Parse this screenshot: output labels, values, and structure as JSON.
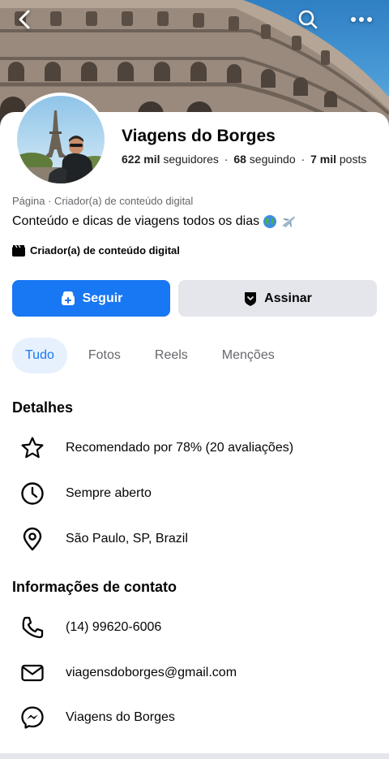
{
  "cover": {
    "back_icon": "chevron-left-icon",
    "search_icon": "search-icon",
    "more_icon": "more-horizontal-icon"
  },
  "profile": {
    "name": "Viagens do Borges",
    "followers_count": "622 mil",
    "followers_label": "seguidores",
    "following_count": "68",
    "following_label": "seguindo",
    "posts_count": "7 mil",
    "posts_label": "posts",
    "separator": "·",
    "category": "Página · Criador(a) de conteúdo digital",
    "bio": "Conteúdo e dicas de viagens todos os dias",
    "bio_emojis": [
      "globe-emoji",
      "airplane-emoji"
    ],
    "badge": "Criador(a) de conteúdo digital"
  },
  "actions": {
    "follow_label": "Seguir",
    "subscribe_label": "Assinar"
  },
  "tabs": [
    {
      "label": "Tudo",
      "active": true
    },
    {
      "label": "Fotos",
      "active": false
    },
    {
      "label": "Reels",
      "active": false
    },
    {
      "label": "Menções",
      "active": false
    }
  ],
  "details": {
    "title": "Detalhes",
    "items": [
      {
        "icon": "star-icon",
        "text": "Recomendado por 78% (20 avaliações)"
      },
      {
        "icon": "clock-icon",
        "text": "Sempre aberto"
      },
      {
        "icon": "location-pin-icon",
        "text": "São Paulo, SP, Brazil"
      }
    ]
  },
  "contact": {
    "title": "Informações de contato",
    "items": [
      {
        "icon": "phone-icon",
        "text": "(14) 99620-6006"
      },
      {
        "icon": "mail-icon",
        "text": "viagensdoborges@gmail.com"
      },
      {
        "icon": "messenger-icon",
        "text": "Viagens do Borges"
      }
    ]
  },
  "colors": {
    "primary": "#1877f2",
    "secondary_button": "#e4e6eb",
    "active_tab_bg": "#e7f1fd",
    "muted_text": "#65676b"
  }
}
